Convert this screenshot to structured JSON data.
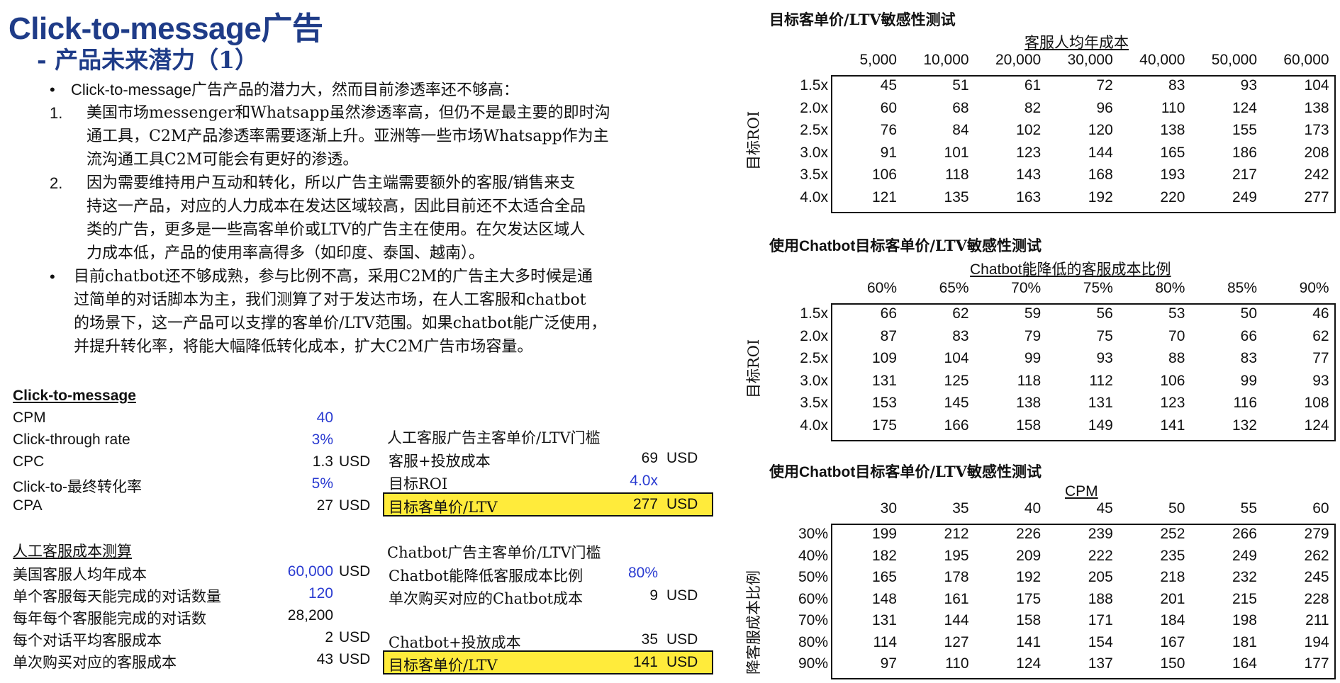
{
  "header": {
    "title": "Click-to-message广告",
    "subtitle": "- 产品未来潜力（1）"
  },
  "body": {
    "bullet1": "Click-to-message广告产品的潜力大，然而目前渗透率还不够高：",
    "item1_num": "1.",
    "item1_lines": [
      "美国市场messenger和Whatsapp虽然渗透率高，但仍不是最主要的即时沟",
      "通工具，C2M产品渗透率需要逐渐上升。亚洲等一些市场Whatsapp作为主",
      "流沟通工具C2M可能会有更好的渗透。"
    ],
    "item2_num": "2.",
    "item2_lines": [
      "因为需要维持用户互动和转化，所以广告主端需要额外的客服/销售来支",
      "持这一产品，对应的人力成本在发达区域较高，因此目前还不太适合全品",
      "类的广告，更多是一些高客单价或LTV的广告主在使用。在欠发达区域人",
      "力成本低，产品的使用率高得多（如印度、泰国、越南）。"
    ],
    "bullet2_lines": [
      "目前chatbot还不够成熟，参与比例不高，采用C2M的广告主大多时候是通",
      "过简单的对话脚本为主，我们测算了对于发达市场，在人工客服和chatbot",
      "的场景下，这一产品可以支撑的客单价/LTV范围。如果chatbot能广泛使用，",
      "并提升转化率，将能大幅降低转化成本，扩大C2M广告市场容量。"
    ]
  },
  "c2m": {
    "heading": "Click-to-message",
    "rows": [
      {
        "label": "CPM",
        "value": "40",
        "unit": "",
        "blue": true
      },
      {
        "label": "Click-through rate",
        "value": "3%",
        "unit": "",
        "blue": true
      },
      {
        "label": "CPC",
        "value": "1.3",
        "unit": "USD",
        "blue": false
      },
      {
        "label": "Click-to-最终转化率",
        "value": "5%",
        "unit": "",
        "blue": true
      },
      {
        "label": "CPA",
        "value": "27",
        "unit": "USD",
        "blue": false
      }
    ]
  },
  "human_cost": {
    "heading": "人工客服成本测算",
    "rows": [
      {
        "label": "美国客服人均年成本",
        "value": "60,000",
        "unit": "USD",
        "blue": true
      },
      {
        "label": "单个客服每天能完成的对话数量",
        "value": "120",
        "unit": "",
        "blue": true
      },
      {
        "label": "每年每个客服能完成的对话数",
        "value": "28,200",
        "unit": "",
        "blue": false
      },
      {
        "label": "每个对话平均客服成本",
        "value": "2",
        "unit": "USD",
        "blue": false
      },
      {
        "label": "单次购买对应的客服成本",
        "value": "43",
        "unit": "USD",
        "blue": false
      }
    ]
  },
  "human_ltv": {
    "heading": "人工客服广告主客单价/LTV门槛",
    "rows": [
      {
        "label": "客服+投放成本",
        "value": "69",
        "unit": "USD",
        "blue": false
      },
      {
        "label": "目标ROI",
        "value": "4.0x",
        "unit": "",
        "blue": true
      }
    ],
    "result": {
      "label": "目标客单价/LTV",
      "value": "277",
      "unit": "USD"
    }
  },
  "chatbot_ltv": {
    "heading": "Chatbot广告主客单价/LTV门槛",
    "rows": [
      {
        "label": "Chatbot能降低客服成本比例",
        "value": "80%",
        "unit": "",
        "blue": true
      },
      {
        "label": "单次购买对应的Chatbot成本",
        "value": "9",
        "unit": "USD",
        "blue": false
      },
      {
        "label": "Chatbot+投放成本",
        "value": "35",
        "unit": "USD",
        "blue": false
      }
    ],
    "result": {
      "label": "目标客单价/LTV",
      "value": "141",
      "unit": "USD"
    }
  },
  "sens1": {
    "title": "目标客单价/LTV敏感性测试",
    "caption": "客服人均年成本",
    "row_axis": "目标ROI",
    "cols": [
      "5,000",
      "10,000",
      "20,000",
      "30,000",
      "40,000",
      "50,000",
      "60,000"
    ],
    "rows": [
      "1.5x",
      "2.0x",
      "2.5x",
      "3.0x",
      "3.5x",
      "4.0x"
    ],
    "values": [
      [
        "45",
        "51",
        "61",
        "72",
        "83",
        "93",
        "104"
      ],
      [
        "60",
        "68",
        "82",
        "96",
        "110",
        "124",
        "138"
      ],
      [
        "76",
        "84",
        "102",
        "120",
        "138",
        "155",
        "173"
      ],
      [
        "91",
        "101",
        "123",
        "144",
        "165",
        "186",
        "208"
      ],
      [
        "106",
        "118",
        "143",
        "168",
        "193",
        "217",
        "242"
      ],
      [
        "121",
        "135",
        "163",
        "192",
        "220",
        "249",
        "277"
      ]
    ]
  },
  "sens2": {
    "title_pre": "使用",
    "title_bold": "Chatbot",
    "title_post": "目标客单价/LTV敏感性测试",
    "caption": "Chatbot能降低的客服成本比例",
    "row_axis": "目标ROI",
    "cols": [
      "60%",
      "65%",
      "70%",
      "75%",
      "80%",
      "85%",
      "90%"
    ],
    "rows": [
      "1.5x",
      "2.0x",
      "2.5x",
      "3.0x",
      "3.5x",
      "4.0x"
    ],
    "values": [
      [
        "66",
        "62",
        "59",
        "56",
        "53",
        "50",
        "46"
      ],
      [
        "87",
        "83",
        "79",
        "75",
        "70",
        "66",
        "62"
      ],
      [
        "109",
        "104",
        "99",
        "93",
        "88",
        "83",
        "77"
      ],
      [
        "131",
        "125",
        "118",
        "112",
        "106",
        "99",
        "93"
      ],
      [
        "153",
        "145",
        "138",
        "131",
        "123",
        "116",
        "108"
      ],
      [
        "175",
        "166",
        "158",
        "149",
        "141",
        "132",
        "124"
      ]
    ]
  },
  "sens3": {
    "title_pre": "使用",
    "title_bold": "Chatbot",
    "title_post": "目标客单价/LTV敏感性测试",
    "caption": "CPM",
    "row_axis": "降客服成本比例",
    "cols": [
      "30",
      "35",
      "40",
      "45",
      "50",
      "55",
      "60"
    ],
    "rows": [
      "30%",
      "40%",
      "50%",
      "60%",
      "70%",
      "80%",
      "90%"
    ],
    "values": [
      [
        "199",
        "212",
        "226",
        "239",
        "252",
        "266",
        "279"
      ],
      [
        "182",
        "195",
        "209",
        "222",
        "235",
        "249",
        "262"
      ],
      [
        "165",
        "178",
        "192",
        "205",
        "218",
        "232",
        "245"
      ],
      [
        "148",
        "161",
        "175",
        "188",
        "201",
        "215",
        "228"
      ],
      [
        "131",
        "144",
        "158",
        "171",
        "184",
        "198",
        "211"
      ],
      [
        "114",
        "127",
        "141",
        "154",
        "167",
        "181",
        "194"
      ],
      [
        "97",
        "110",
        "124",
        "137",
        "150",
        "164",
        "177"
      ]
    ]
  }
}
